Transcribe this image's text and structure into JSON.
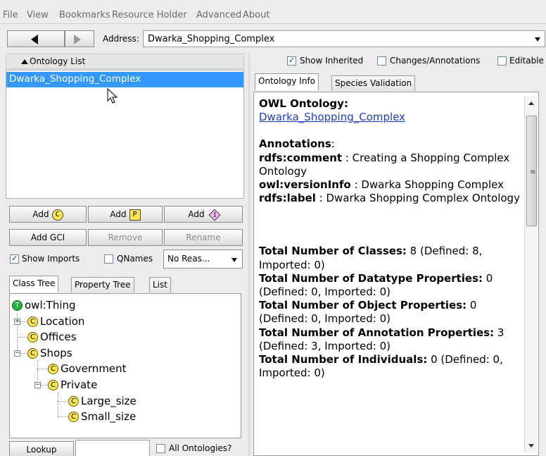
{
  "menu": [
    "File",
    "View",
    "Bookmarks",
    "Resource Holder",
    "Advanced",
    "About"
  ],
  "address": {
    "label": "Address:",
    "value": "Dwarka_Shopping_Complex"
  },
  "ontology_list": {
    "header": "Ontology List",
    "items": [
      "Dwarka_Shopping_Complex"
    ]
  },
  "buttons": {
    "add": "Add",
    "add_class_tag": "C",
    "add_prop_tag": "P",
    "add_ind_tag": "I",
    "add_gci": "Add GCI",
    "remove": "Remove",
    "rename": "Rename"
  },
  "options": {
    "show_imports": "Show Imports",
    "qnames": "QNames",
    "reasoner": "No Reas..."
  },
  "tree_tabs": [
    "Class Tree",
    "Property Tree",
    "List"
  ],
  "class_tree": {
    "root": "owl:Thing",
    "root_icon": "T",
    "class_icon": "C",
    "nodes": [
      "Location",
      "Offices",
      "Shops",
      "Government",
      "Private",
      "Large_size",
      "Small_size"
    ]
  },
  "lookup": {
    "button": "Lookup",
    "all_ontologies": "All Ontologies?"
  },
  "toolbar_right": {
    "show_inherited": "Show Inherited",
    "changes": "Changes/Annotations",
    "editable": "Editable"
  },
  "info_tabs": [
    "Ontology Info",
    "Species Validation"
  ],
  "info": {
    "owl_heading": "OWL Ontology:",
    "ontology_link": "Dwarka_Shopping_Complex",
    "annotations_heading": "Annotations",
    "ann": [
      {
        "key": "rdfs:comment",
        "value": " : Creating a Shopping Complex Ontology"
      },
      {
        "key": "owl:versionInfo",
        "value": " : Dwarka Shopping Complex"
      },
      {
        "key": "rdfs:label",
        "value": " : Dwarka Shopping Complex Ontology"
      }
    ],
    "stats": [
      {
        "key": "Total Number of Classes:",
        "value": " 8 (Defined: 8, Imported: 0)"
      },
      {
        "key": "Total Number of Datatype Properties:",
        "value": " 0 (Defined: 0, Imported: 0)"
      },
      {
        "key": "Total Number of Object Properties:",
        "value": " 0 (Defined: 0, Imported: 0)"
      },
      {
        "key": "Total Number of Annotation Properties:",
        "value": " 3 (Defined: 3, Imported: 0)"
      },
      {
        "key": "Total Number of Individuals:",
        "value": " 0 (Defined: 0, Imported: 0)"
      }
    ]
  },
  "colors": {
    "selection": "#3399ff",
    "link": "#1d3cc8",
    "class_icon": "#ffe74a",
    "thing_icon": "#22b43c"
  }
}
